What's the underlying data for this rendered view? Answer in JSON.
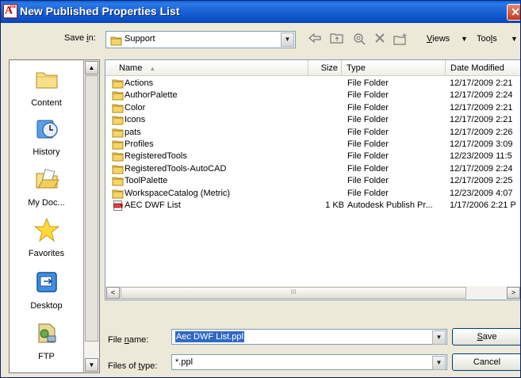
{
  "window": {
    "title": "New Published Properties List",
    "close_glyph": "✕"
  },
  "save_in": {
    "label_prefix": "Save ",
    "label_key": "i",
    "label_suffix": "n:",
    "value": "Support"
  },
  "toolbar": {
    "back_icon": "back-arrow-icon",
    "up_icon": "up-folder-icon",
    "search_icon": "search-web-icon",
    "delete_icon": "delete-icon",
    "newfolder_icon": "new-folder-icon",
    "views_key": "V",
    "views_rest": "iews",
    "views_arrow": "▼",
    "tools_prefix": "Too",
    "tools_key": "l",
    "tools_suffix": "s",
    "tools_arrow": "▼"
  },
  "places": [
    {
      "label": "Content",
      "icon": "folder-icon"
    },
    {
      "label": "History",
      "icon": "history-clock-icon"
    },
    {
      "label": "My Doc...",
      "icon": "my-documents-icon"
    },
    {
      "label": "Favorites",
      "icon": "favorites-star-icon"
    },
    {
      "label": "Desktop",
      "icon": "desktop-icon"
    },
    {
      "label": "FTP",
      "icon": "ftp-icon"
    }
  ],
  "columns": {
    "name": "Name",
    "sort_arrow": "▲",
    "size": "Size",
    "type": "Type",
    "date": "Date Modified"
  },
  "files": [
    {
      "name": "Actions",
      "size": "",
      "type": "File Folder",
      "date": "12/17/2009 2:21"
    },
    {
      "name": "AuthorPalette",
      "size": "",
      "type": "File Folder",
      "date": "12/17/2009 2:24"
    },
    {
      "name": "Color",
      "size": "",
      "type": "File Folder",
      "date": "12/17/2009 2:21"
    },
    {
      "name": "Icons",
      "size": "",
      "type": "File Folder",
      "date": "12/17/2009 2:21"
    },
    {
      "name": "pats",
      "size": "",
      "type": "File Folder",
      "date": "12/17/2009 2:26"
    },
    {
      "name": "Profiles",
      "size": "",
      "type": "File Folder",
      "date": "12/17/2009 3:09"
    },
    {
      "name": "RegisteredTools",
      "size": "",
      "type": "File Folder",
      "date": "12/23/2009 11:5"
    },
    {
      "name": "RegisteredTools-AutoCAD",
      "size": "",
      "type": "File Folder",
      "date": "12/17/2009 2:24"
    },
    {
      "name": "ToolPalette",
      "size": "",
      "type": "File Folder",
      "date": "12/17/2009 2:25"
    },
    {
      "name": "WorkspaceCatalog (Metric)",
      "size": "",
      "type": "File Folder",
      "date": "12/23/2009 4:07"
    },
    {
      "name": "AEC DWF List",
      "size": "1 KB",
      "type": "Autodesk Publish Pr...",
      "date": "1/17/2006 2:21 P"
    }
  ],
  "file_name": {
    "label_prefix": "File ",
    "label_key": "n",
    "label_suffix": "ame:",
    "value": "Aec DWF List.ppl"
  },
  "file_type": {
    "label_prefix": "Files of ",
    "label_key": "t",
    "label_suffix": "ype:",
    "value": "*.ppl"
  },
  "buttons": {
    "save_key": "S",
    "save_rest": "ave",
    "cancel": "Cancel"
  },
  "scroll": {
    "left": "<",
    "right": ">",
    "grip": "III",
    "up": "^",
    "down": "v"
  },
  "colors": {
    "titlebar": "#0a4fc6",
    "selection": "#316ac5",
    "folder": "#f5d468"
  }
}
